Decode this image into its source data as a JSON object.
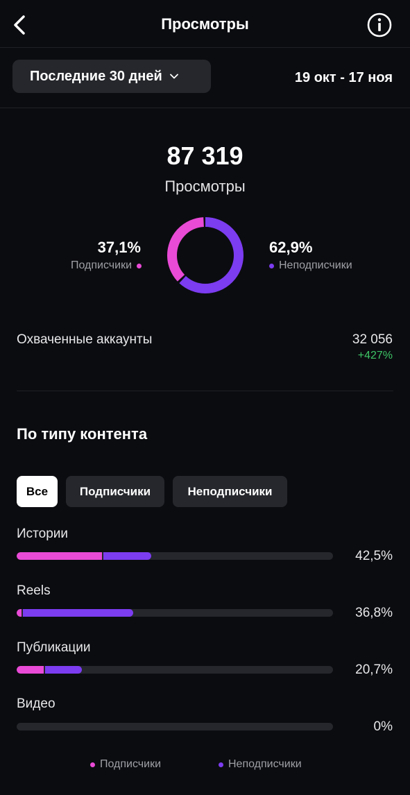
{
  "header": {
    "title": "Просмотры"
  },
  "filter": {
    "range_label": "Последние 30 дней",
    "dates": "19 окт - 17 ноя"
  },
  "summary": {
    "total": "87 319",
    "label": "Просмотры",
    "followers_pct": "37,1%",
    "followers_label": "Подписчики",
    "followers_fraction": 0.371,
    "nonfollowers_pct": "62,9%",
    "nonfollowers_label": "Неподписчики",
    "nonfollowers_fraction": 0.629
  },
  "reach": {
    "label": "Охваченные аккаунты",
    "value": "32 056",
    "change": "+427%"
  },
  "content": {
    "title": "По типу контента",
    "tabs": [
      "Все",
      "Подписчики",
      "Неподписчики"
    ],
    "rows": [
      {
        "label": "Истории",
        "value": "42,5%",
        "followers_fraction": 0.27,
        "nonfollowers_fraction": 0.155
      },
      {
        "label": "Reels",
        "value": "36,8%",
        "followers_fraction": 0.015,
        "nonfollowers_fraction": 0.353
      },
      {
        "label": "Публикации",
        "value": "20,7%",
        "followers_fraction": 0.085,
        "nonfollowers_fraction": 0.122
      },
      {
        "label": "Видео",
        "value": "0%",
        "followers_fraction": 0,
        "nonfollowers_fraction": 0
      }
    ]
  },
  "legend": {
    "followers": "Подписчики",
    "nonfollowers": "Неподписчики"
  },
  "colors": {
    "followers": "#e94ad6",
    "nonfollowers": "#7c3cf0",
    "positive": "#3ec466"
  }
}
